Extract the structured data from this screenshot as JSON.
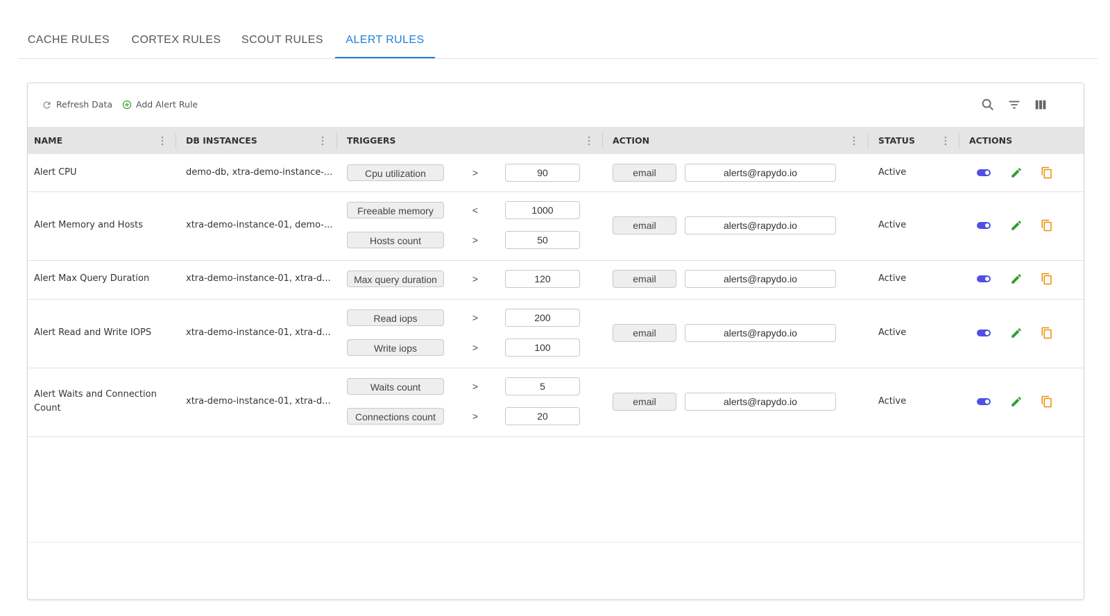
{
  "tabs": [
    {
      "label": "CACHE RULES"
    },
    {
      "label": "CORTEX RULES"
    },
    {
      "label": "SCOUT RULES"
    },
    {
      "label": "ALERT RULES"
    }
  ],
  "active_tab": "ALERT RULES",
  "toolbar": {
    "refresh_label": "Refresh Data",
    "add_label": "Add Alert Rule",
    "icons": [
      "refresh-icon",
      "add-circle-icon",
      "search-icon",
      "filter-icon",
      "columns-icon"
    ]
  },
  "columns": [
    {
      "label": "NAME"
    },
    {
      "label": "DB INSTANCES"
    },
    {
      "label": "TRIGGERS"
    },
    {
      "label": "ACTION"
    },
    {
      "label": "STATUS"
    },
    {
      "label": "ACTIONS"
    }
  ],
  "rows": [
    {
      "name": "Alert CPU",
      "instances": "demo-db, xtra-demo-instance-...",
      "triggers": [
        {
          "metric": "Cpu utilization",
          "op": ">",
          "value": "90"
        }
      ],
      "action_type": "email",
      "action_target": "alerts@rapydo.io",
      "status": "Active"
    },
    {
      "name": "Alert Memory and Hosts",
      "instances": "xtra-demo-instance-01, demo-...",
      "triggers": [
        {
          "metric": "Freeable memory",
          "op": "<",
          "value": "1000"
        },
        {
          "metric": "Hosts count",
          "op": ">",
          "value": "50"
        }
      ],
      "action_type": "email",
      "action_target": "alerts@rapydo.io",
      "status": "Active"
    },
    {
      "name": "Alert Max Query Duration",
      "instances": "xtra-demo-instance-01, xtra-d...",
      "triggers": [
        {
          "metric": "Max query duration",
          "op": ">",
          "value": "120"
        }
      ],
      "action_type": "email",
      "action_target": "alerts@rapydo.io",
      "status": "Active"
    },
    {
      "name": "Alert Read and Write IOPS",
      "instances": "xtra-demo-instance-01, xtra-d...",
      "triggers": [
        {
          "metric": "Read iops",
          "op": ">",
          "value": "200"
        },
        {
          "metric": "Write iops",
          "op": ">",
          "value": "100"
        }
      ],
      "action_type": "email",
      "action_target": "alerts@rapydo.io",
      "status": "Active"
    },
    {
      "name": "Alert Waits and Connection Count",
      "instances": "xtra-demo-instance-01, xtra-d...",
      "triggers": [
        {
          "metric": "Waits count",
          "op": ">",
          "value": "5"
        },
        {
          "metric": "Connections count",
          "op": ">",
          "value": "20"
        }
      ],
      "action_type": "email",
      "action_target": "alerts@rapydo.io",
      "status": "Active"
    }
  ],
  "colors": {
    "accent": "#1e7ed6",
    "toggle": "#4f4fe6",
    "edit": "#2e9e2e",
    "copy": "#f08c00"
  }
}
